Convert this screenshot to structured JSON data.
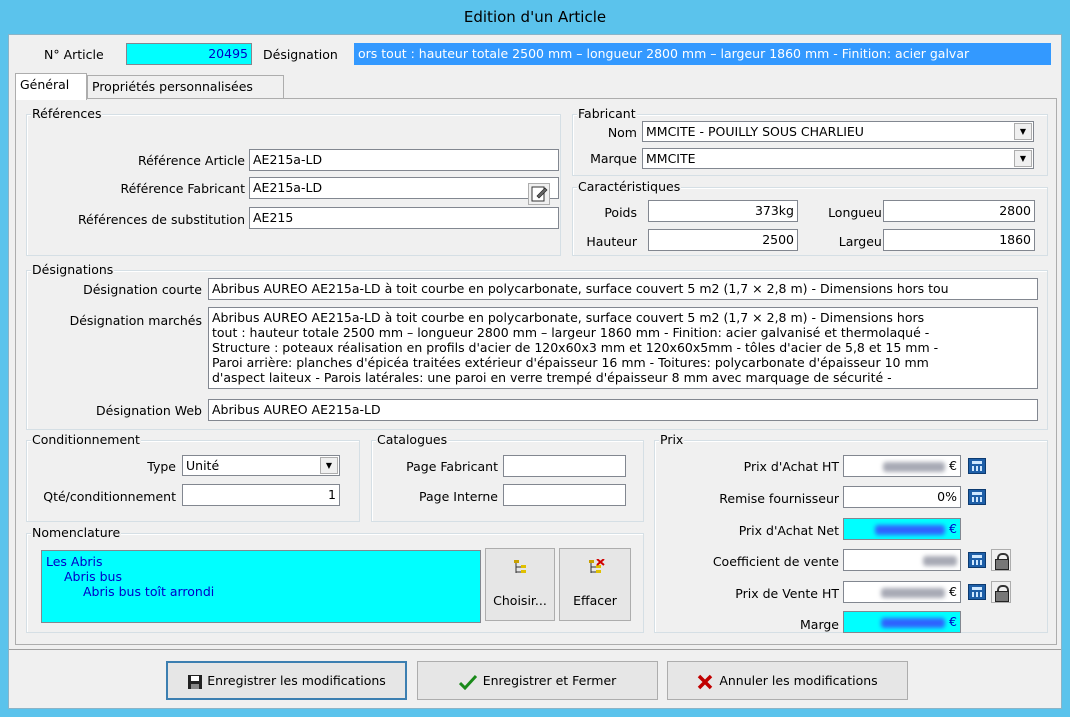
{
  "window": {
    "title": "Edition d'un Article"
  },
  "header": {
    "article_label": "N° Article",
    "article_value": "20495",
    "designation_label": "Désignation",
    "designation_value": "ors tout : hauteur totale 2500 mm – longueur 2800 mm – largeur 1860 mm - Finition: acier galvar"
  },
  "tabs": [
    {
      "label": "Général",
      "active": true
    },
    {
      "label": "Propriétés personnalisées",
      "active": false
    }
  ],
  "references": {
    "title": "Références",
    "ref_article_label": "Référence Article",
    "ref_article_value": "AE215a-LD",
    "ref_fabricant_label": "Référence Fabricant",
    "ref_fabricant_value": "AE215a-LD",
    "ref_substitution_label": "Références de substitution",
    "ref_substitution_value": "AE215"
  },
  "fabricant": {
    "title": "Fabricant",
    "nom_label": "Nom",
    "nom_value": "MMCITE - POUILLY SOUS CHARLIEU",
    "marque_label": "Marque",
    "marque_value": "MMCITE"
  },
  "caracteristiques": {
    "title": "Caractéristiques",
    "poids_label": "Poids",
    "poids_value": "373kg",
    "longueur_label": "Longueur",
    "longueur_value": "2800",
    "hauteur_label": "Hauteur",
    "hauteur_value": "2500",
    "largeur_label": "Largeur",
    "largeur_value": "1860"
  },
  "designations": {
    "title": "Désignations",
    "courte_label": "Désignation courte",
    "courte_value": "Abribus AUREO AE215a-LD à toit courbe en polycarbonate, surface couvert 5 m2 (1,7 × 2,8 m) - Dimensions hors tou",
    "marches_label": "Désignation marchés",
    "marches_lines": [
      "Abribus AUREO AE215a-LD à toit courbe en polycarbonate, surface couvert 5 m2 (1,7 × 2,8 m) - Dimensions hors",
      "tout : hauteur totale 2500 mm – longueur 2800 mm – largeur 1860 mm - Finition: acier galvanisé et thermolaqué -",
      "Structure : poteaux réalisation en profils d'acier de 120x60x3 mm et 120x60x5mm - tôles d'acier de 5,8 et 15 mm -",
      "Paroi arrière: planches d'épicéa traitées extérieur d'épaisseur 16 mm - Toitures: polycarbonate d'épaisseur 10 mm",
      "d'aspect laiteux - Parois latérales: une paroi en verre trempé d'épaisseur 8 mm avec marquage de sécurité -"
    ],
    "web_label": "Désignation Web",
    "web_value": "Abribus AUREO AE215a-LD"
  },
  "conditionnement": {
    "title": "Conditionnement",
    "type_label": "Type",
    "type_value": "Unité",
    "qte_label": "Qté/conditionnement",
    "qte_value": "1"
  },
  "catalogues": {
    "title": "Catalogues",
    "page_fabricant_label": "Page Fabricant",
    "page_fabricant_value": "",
    "page_interne_label": "Page Interne",
    "page_interne_value": ""
  },
  "nomenclature": {
    "title": "Nomenclature",
    "items": [
      "Les Abris",
      "Abris bus",
      "Abris bus toît arrondi"
    ],
    "choose_label": "Choisir...",
    "clear_label": "Effacer"
  },
  "prix": {
    "title": "Prix",
    "achat_ht_label": "Prix d'Achat HT",
    "achat_ht_suffix": "€",
    "remise_label": "Remise fournisseur",
    "remise_value": "0%",
    "achat_net_label": "Prix d'Achat Net",
    "achat_net_suffix": "€",
    "coef_label": "Coefficient de vente",
    "vente_ht_label": "Prix de Vente HT",
    "vente_ht_suffix": "€",
    "marge_label": "Marge",
    "marge_suffix": "€"
  },
  "footer": {
    "save_label": "Enregistrer les modifications",
    "save_close_label": "Enregistrer et Fermer",
    "cancel_label": "Annuler les modifications"
  },
  "colors": {
    "titlebar": "#5bc3ec",
    "cyan_field": "#00ffff",
    "selection": "#3399ff"
  },
  "icons": [
    "save-icon",
    "checkmark-icon",
    "cross-icon",
    "calculator-icon",
    "lock-icon",
    "tree-icon",
    "tree-delete-icon",
    "edit-icon",
    "chevron-down-icon"
  ]
}
